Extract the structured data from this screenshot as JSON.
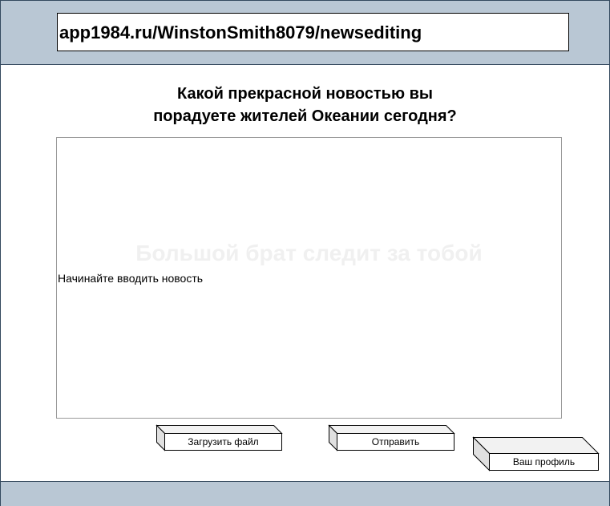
{
  "browser": {
    "url": "app1984.ru/WinstonSmith8079/newsediting"
  },
  "main": {
    "heading_line1": "Какой прекрасной новостью вы",
    "heading_line2": "порадуете жителей Океании сегодня?",
    "watermark": "Большой брат следит за тобой",
    "editor_placeholder": "Начинайте вводить новость"
  },
  "actions": {
    "upload_label": "Загрузить файл",
    "send_label": "Отправить",
    "profile_label": "Ваш профиль"
  },
  "colors": {
    "bar": "#b9c7d4",
    "border": "#34495e"
  }
}
